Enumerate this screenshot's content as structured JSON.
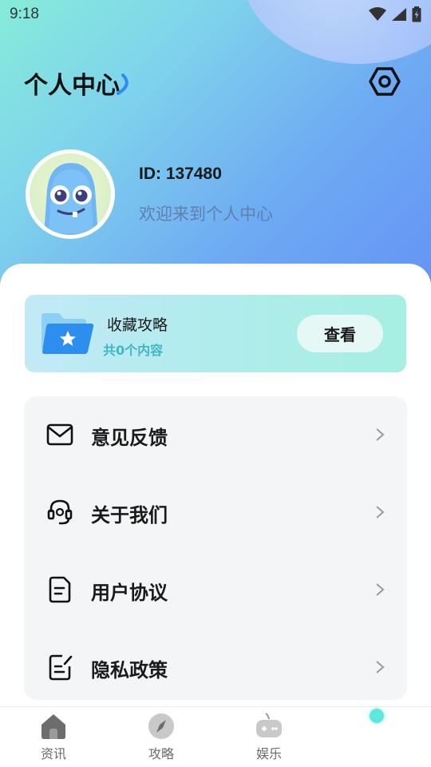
{
  "status_bar": {
    "time": "9:18"
  },
  "header": {
    "title": "个人中心"
  },
  "profile": {
    "id_text": "ID: 137480",
    "welcome": "欢迎来到个人中心"
  },
  "favorites": {
    "title": "收藏攻略",
    "count_text": "共0个内容",
    "view_label": "查看"
  },
  "menu": {
    "items": [
      {
        "label": "意见反馈",
        "icon": "mail-icon"
      },
      {
        "label": "关于我们",
        "icon": "headset-icon"
      },
      {
        "label": "用户协议",
        "icon": "document-icon"
      },
      {
        "label": "隐私政策",
        "icon": "edit-document-icon"
      }
    ]
  },
  "tabs": [
    {
      "label": "资讯",
      "icon": "home-icon"
    },
    {
      "label": "攻略",
      "icon": "compass-icon"
    },
    {
      "label": "娱乐",
      "icon": "gamepad-icon"
    },
    {
      "label": "",
      "icon": "profile-dot-icon"
    }
  ],
  "colors": {
    "accent": "#5ee6e0",
    "header_start": "#86ecd9",
    "header_end": "#6493f5"
  }
}
